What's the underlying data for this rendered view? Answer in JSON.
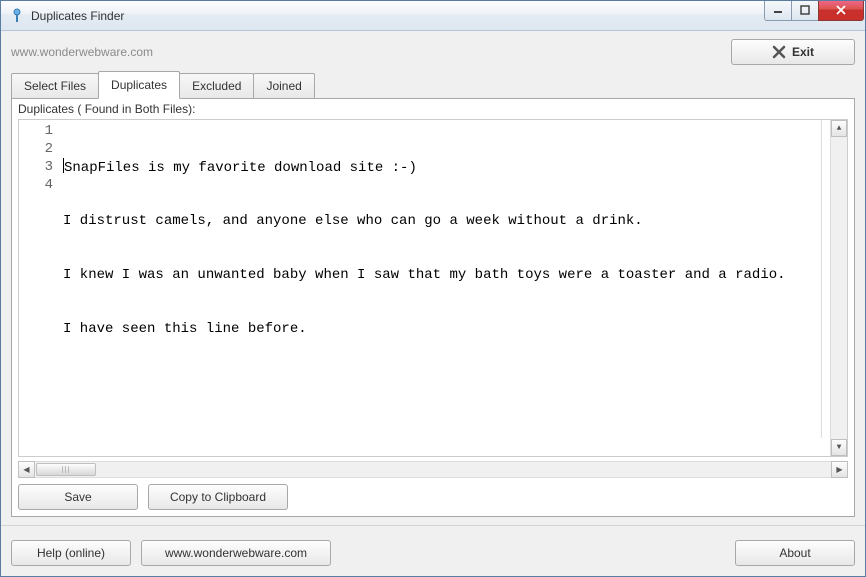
{
  "window": {
    "title": "Duplicates Finder"
  },
  "header": {
    "site_label": "www.wonderwebware.com",
    "exit_label": "Exit"
  },
  "tabs": [
    {
      "label": "Select Files",
      "active": false
    },
    {
      "label": "Duplicates",
      "active": true
    },
    {
      "label": "Excluded",
      "active": false
    },
    {
      "label": "Joined",
      "active": false
    }
  ],
  "panel": {
    "heading": "Duplicates ( Found in Both Files):",
    "lines": [
      "SnapFiles is my favorite download site :-)",
      "I distrust camels, and anyone else who can go a week without a drink.",
      "I knew I was an unwanted baby when I saw that my bath toys were a toaster and a radio.",
      "I have seen this line before."
    ]
  },
  "actions": {
    "save": "Save",
    "copy": "Copy to Clipboard"
  },
  "footer": {
    "help": "Help (online)",
    "site": "www.wonderwebware.com",
    "about": "About"
  }
}
